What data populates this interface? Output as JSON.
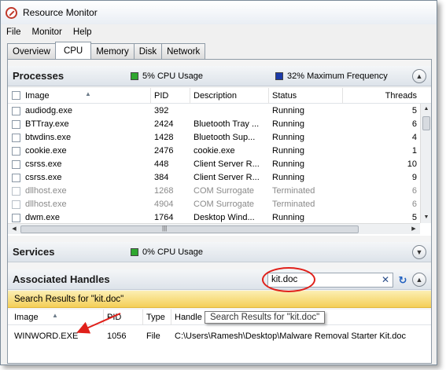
{
  "window": {
    "title": "Resource Monitor"
  },
  "menu": [
    "File",
    "Monitor",
    "Help"
  ],
  "tabs": [
    "Overview",
    "CPU",
    "Memory",
    "Disk",
    "Network"
  ],
  "active_tab": "CPU",
  "processes": {
    "title": "Processes",
    "cpu_usage": "5% CPU Usage",
    "max_frequency": "32% Maximum Frequency",
    "columns": [
      "Image",
      "PID",
      "Description",
      "Status",
      "Threads"
    ],
    "rows": [
      {
        "image": "audiodg.exe",
        "pid": "392",
        "description": "",
        "status": "Running",
        "threads": "5",
        "terminated": false
      },
      {
        "image": "BTTray.exe",
        "pid": "2424",
        "description": "Bluetooth Tray ...",
        "status": "Running",
        "threads": "6",
        "terminated": false
      },
      {
        "image": "btwdins.exe",
        "pid": "1428",
        "description": "Bluetooth Sup...",
        "status": "Running",
        "threads": "4",
        "terminated": false
      },
      {
        "image": "cookie.exe",
        "pid": "2476",
        "description": "cookie.exe",
        "status": "Running",
        "threads": "1",
        "terminated": false
      },
      {
        "image": "csrss.exe",
        "pid": "448",
        "description": "Client Server R...",
        "status": "Running",
        "threads": "10",
        "terminated": false
      },
      {
        "image": "csrss.exe",
        "pid": "384",
        "description": "Client Server R...",
        "status": "Running",
        "threads": "9",
        "terminated": false
      },
      {
        "image": "dllhost.exe",
        "pid": "1268",
        "description": "COM Surrogate",
        "status": "Terminated",
        "threads": "6",
        "terminated": true
      },
      {
        "image": "dllhost.exe",
        "pid": "4904",
        "description": "COM Surrogate",
        "status": "Terminated",
        "threads": "6",
        "terminated": true
      },
      {
        "image": "dwm.exe",
        "pid": "1764",
        "description": "Desktop Wind...",
        "status": "Running",
        "threads": "5",
        "terminated": false
      }
    ]
  },
  "services": {
    "title": "Services",
    "cpu_usage": "0% CPU Usage"
  },
  "handles": {
    "title": "Associated Handles",
    "search_value": "kit.doc",
    "results_label": "Search Results for \"kit.doc\"",
    "tooltip": "Search Results for \"kit.doc\"",
    "columns": [
      "Image",
      "PID",
      "Type",
      "Handle Name"
    ],
    "rows": [
      {
        "image": "WINWORD.EXE",
        "pid": "1056",
        "type": "File",
        "handle_name": "C:\\Users\\Ramesh\\Desktop\\Malware Removal Starter Kit.doc"
      }
    ]
  },
  "colors": {
    "cpu_usage": "#2fa72f",
    "max_frequency": "#1c3aa8",
    "results_bar": "#f4cf58",
    "annotation": "#e0201a"
  }
}
